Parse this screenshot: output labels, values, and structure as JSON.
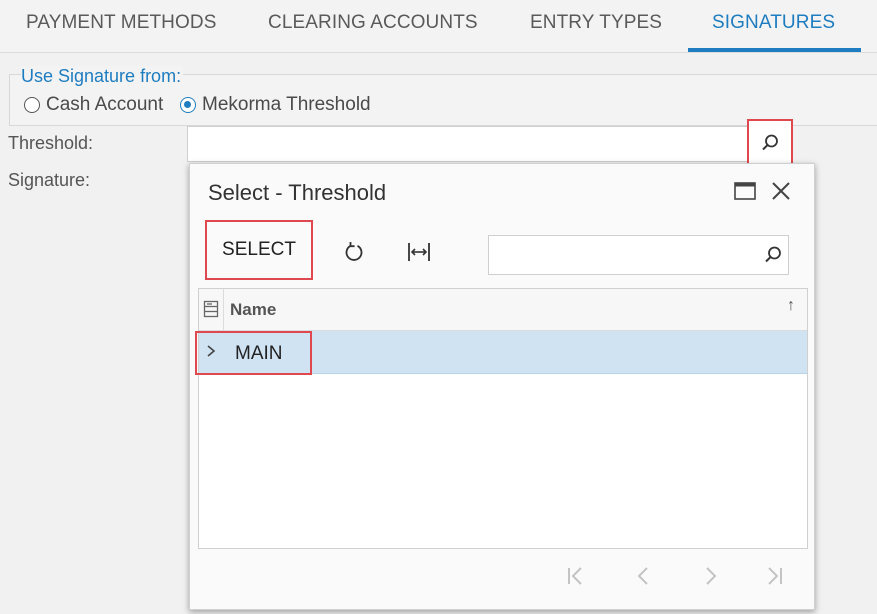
{
  "tabs": [
    {
      "label": "PAYMENT METHODS"
    },
    {
      "label": "CLEARING ACCOUNTS"
    },
    {
      "label": "ENTRY TYPES"
    },
    {
      "label": "SIGNATURES",
      "active": true
    }
  ],
  "signature_group": {
    "legend": "Use Signature from:",
    "options": [
      {
        "label": "Cash Account",
        "checked": false
      },
      {
        "label": "Mekorma Threshold",
        "checked": true
      }
    ]
  },
  "fields": {
    "threshold_label": "Threshold:",
    "threshold_value": "",
    "signature_label": "Signature:"
  },
  "dialog": {
    "title": "Select - Threshold",
    "select_label": "SELECT",
    "search_value": "",
    "grid": {
      "columns": [
        "Name"
      ],
      "sort": "ascending",
      "rows": [
        {
          "name": "MAIN",
          "selected": true
        }
      ]
    }
  },
  "colors": {
    "accent": "#1e7dc1",
    "highlight_box": "#e0484f",
    "selected_row": "#cfe3f3"
  }
}
